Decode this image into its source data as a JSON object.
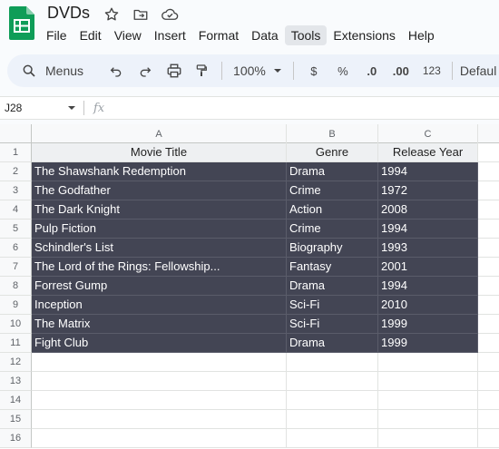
{
  "app": {
    "doc_title": "DVDs",
    "menus": [
      "File",
      "Edit",
      "View",
      "Insert",
      "Format",
      "Data",
      "Tools",
      "Extensions",
      "Help"
    ],
    "active_menu": "Tools"
  },
  "toolbar": {
    "search_label": "Menus",
    "zoom": "100%",
    "currency": "$",
    "percent": "%",
    "decrease_decimals": ".0",
    "increase_decimals": ".00",
    "number_format": "123",
    "font": "Defaul"
  },
  "formula_bar": {
    "cell_ref": "J28",
    "fx_label": "fx"
  },
  "sheet": {
    "columns": [
      "A",
      "B",
      "C"
    ],
    "row_numbers": [
      "1",
      "2",
      "3",
      "4",
      "5",
      "6",
      "7",
      "8",
      "9",
      "10",
      "11",
      "12",
      "13",
      "14",
      "15",
      "16"
    ],
    "header": {
      "title": "Movie Title",
      "genre": "Genre",
      "year": "Release Year"
    },
    "rows": [
      {
        "title": "The Shawshank Redemption",
        "genre": "Drama",
        "year": "1994"
      },
      {
        "title": "The Godfather",
        "genre": "Crime",
        "year": "1972"
      },
      {
        "title": "The Dark Knight",
        "genre": "Action",
        "year": "2008"
      },
      {
        "title": "Pulp Fiction",
        "genre": "Crime",
        "year": "1994"
      },
      {
        "title": "Schindler's List",
        "genre": "Biography",
        "year": "1993"
      },
      {
        "title": "The Lord of the Rings: Fellowship...",
        "genre": "Fantasy",
        "year": "2001"
      },
      {
        "title": "Forrest Gump",
        "genre": "Drama",
        "year": "1994"
      },
      {
        "title": "Inception",
        "genre": "Sci-Fi",
        "year": "2010"
      },
      {
        "title": "The Matrix",
        "genre": "Sci-Fi",
        "year": "1999"
      },
      {
        "title": "Fight Club",
        "genre": "Drama",
        "year": "1999"
      }
    ]
  },
  "colors": {
    "brand_green": "#0f9d58",
    "data_fill": "#434554",
    "header_fill": "#eef0f2"
  },
  "icons": {
    "logo": "sheets-logo-icon",
    "star": "star-icon",
    "move": "folder-move-icon",
    "cloud": "cloud-saved-icon",
    "search": "search-icon",
    "undo": "undo-icon",
    "redo": "redo-icon",
    "print": "print-icon",
    "paint": "paint-format-icon"
  }
}
